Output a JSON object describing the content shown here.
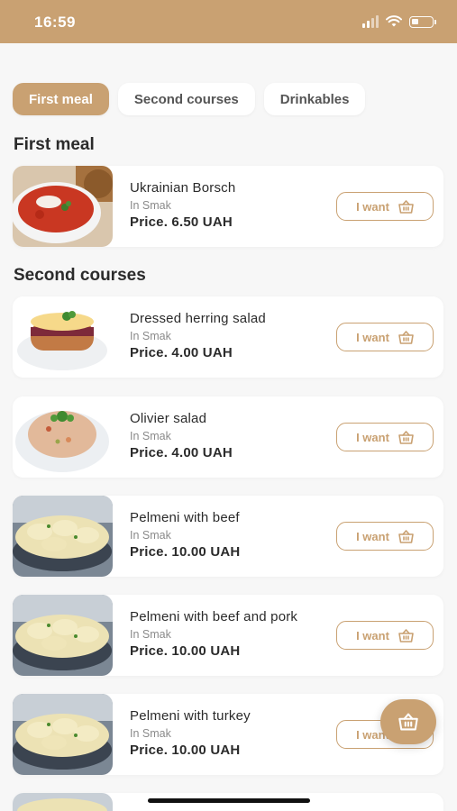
{
  "status_bar": {
    "time": "16:59"
  },
  "tabs": [
    {
      "label": "First meal",
      "active": true
    },
    {
      "label": "Second courses",
      "active": false
    },
    {
      "label": "Drinkables",
      "active": false
    }
  ],
  "sections": [
    {
      "title": "First meal",
      "items": [
        {
          "name": "Ukrainian Borsch",
          "place": "In Smak",
          "price": "Price. 6.50 UAH",
          "image": "borsch"
        }
      ]
    },
    {
      "title": "Second courses",
      "items": [
        {
          "name": "Dressed herring salad",
          "place": "In Smak",
          "price": "Price. 4.00 UAH",
          "image": "herring-salad"
        },
        {
          "name": "Olivier salad",
          "place": "In Smak",
          "price": "Price. 4.00 UAH",
          "image": "olivier-salad"
        },
        {
          "name": "Pelmeni with beef",
          "place": "In Smak",
          "price": "Price. 10.00 UAH",
          "image": "pelmeni"
        },
        {
          "name": "Pelmeni with beef and pork",
          "place": "In Smak",
          "price": "Price. 10.00 UAH",
          "image": "pelmeni"
        },
        {
          "name": "Pelmeni with turkey",
          "place": "In Smak",
          "price": "Price. 10.00 UAH",
          "image": "pelmeni"
        }
      ]
    }
  ],
  "want_label": "I want",
  "colors": {
    "accent": "#c9a172",
    "background": "#f7f7f7",
    "card": "#ffffff"
  },
  "icons": {
    "cart": "basket-icon",
    "cart_fab": "basket-icon"
  }
}
